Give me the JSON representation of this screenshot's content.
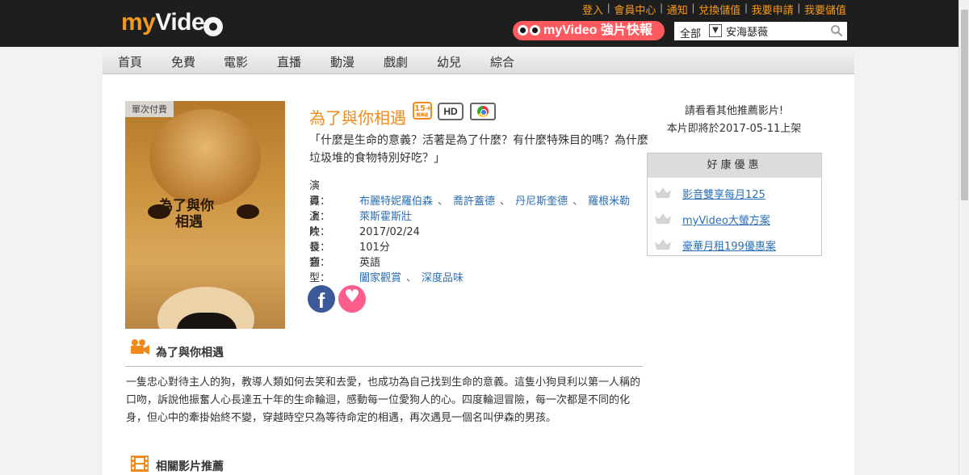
{
  "header": {
    "logo": {
      "prefix": "my",
      "suffix": "Vide"
    },
    "top_links": [
      "登入",
      "會員中心",
      "通知",
      "兌換儲值",
      "我要申請",
      "我要儲值"
    ],
    "promo_label": "myVideo 強片快報",
    "search": {
      "category": "全部",
      "value": "安海瑟薇"
    }
  },
  "nav": {
    "items": [
      "首頁",
      "免費",
      "電影",
      "直播",
      "動漫",
      "戲劇",
      "幼兒",
      "綜合"
    ]
  },
  "movie": {
    "poster_badge": "單次付費",
    "poster_title_line1": "為了與你",
    "poster_title_line2": "相遇",
    "title": "為了與你相遇",
    "rating_badge": "15+",
    "rating_small": "輔導級",
    "hd_badge": "HD",
    "quote": "「什麼是生命的意義？活著是為了什麼？有什麼特殊目的嗎？為什麼垃圾堆的食物特別好吃？」",
    "cast_label": "演　　員：",
    "cast": [
      "布麗特妮羅伯森",
      "喬許蓋德",
      "丹尼斯奎德",
      "羅根米勒"
    ],
    "director_label": "導　　演：",
    "director": "萊斯霍斯壯",
    "release_label": "上　　映：",
    "release": "2017/02/24",
    "length_label": "片　　長：",
    "length": "101分",
    "audio_label": "發　　音：",
    "audio": "英語",
    "genre_label": "類　　型：",
    "genres": [
      "闔家觀賞",
      "深度品味"
    ],
    "synopsis_heading": "為了與你相遇",
    "synopsis": "一隻忠心對待主人的狗，教導人類如何去笑和去愛，也成功為自己找到生命的意義。這隻小狗貝利以第一人稱的口吻，訴說他振奮人心長達五十年的生命輪迴，感動每一位愛狗人的心。四度輪迴冒險，每一次都是不同的化身，但心中的牽掛始終不變，穿越時空只為等待命定的相遇，再次遇見一個名叫伊森的男孩。",
    "related_heading": "相關影片推薦"
  },
  "sidebar": {
    "notice_line1": "請看看其他推薦影片!",
    "notice_line2": "本片即將於2017-05-11上架",
    "offers_title": "好康優惠",
    "offers": [
      "影音雙享每月125",
      "myVideo大螢方案",
      "豪華月租199優惠案"
    ]
  },
  "colors": {
    "accent": "#f08a1c",
    "link": "#2b6fb5",
    "header_bg": "#1e1e1e",
    "promo": "#ff5a5f"
  }
}
